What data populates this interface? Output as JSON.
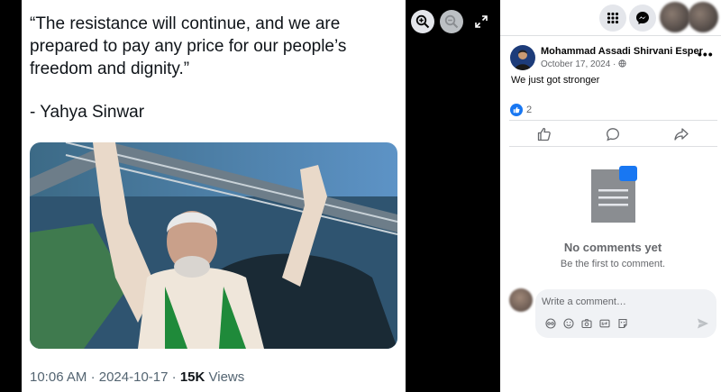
{
  "tweet": {
    "quote": "“The resistance will continue, and we are prepared to pay any price for our people’s freedom and dignity.”",
    "attribution": "- Yahya Sinwar",
    "time": "10:06 AM",
    "date": "2024-10-17",
    "views_count": "15K",
    "views_label": "Views"
  },
  "viewer": {
    "icons": [
      "zoom-in-icon",
      "zoom-out-icon",
      "expand-icon"
    ]
  },
  "post": {
    "author": "Mohammad Assadi Shirvani Esper",
    "date": "October 17, 2024 ·",
    "text": "We just got stronger",
    "reaction_count": "2"
  },
  "comments": {
    "empty_title": "No comments yet",
    "empty_subtitle": "Be the first to comment.",
    "placeholder": "Write a comment…"
  },
  "colors": {
    "accent": "#1877f2",
    "muted": "#65676b",
    "x_text": "#0f1419",
    "x_meta": "#536471"
  }
}
